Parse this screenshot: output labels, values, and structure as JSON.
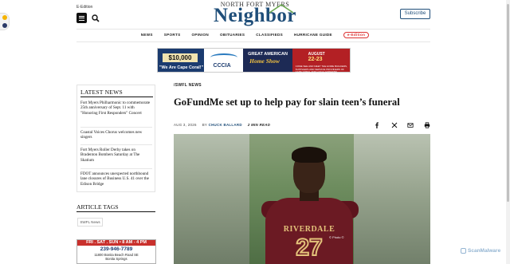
{
  "header": {
    "edition_label": "E-Edition",
    "logo_top": "NORTH FORT MYERS",
    "logo_main": "Neighbor",
    "subscribe_label": "Subscribe"
  },
  "nav": {
    "items": [
      "NEWS",
      "SPORTS",
      "OPINION",
      "OBITUARIES",
      "CLASSIFIEDS",
      "HURRICANE GUIDE"
    ],
    "eedition": "e-Edition"
  },
  "banner": {
    "amount": "$10,000",
    "cape_coral": "\"We Are Cape Coral!\"",
    "ccia": "CCCIA",
    "great_american": "GREAT AMERICAN",
    "home_show": "Home Show",
    "month": "AUGUST",
    "days": "22-23",
    "fine_print": "COME SEE AND MEET THE HOME BUILDERS, SUPPLIERS AND SERVICE PROVIDERS OF CAPE CORAL AND LOCAL EXPERTS!"
  },
  "sidebar": {
    "latest_title": "LATEST NEWS",
    "news": [
      "Fort Myers Philharmonic to commemorate 25th anniversary of Sept. 11 with \"Honoring First Responders\" Concert",
      "Coastal Voices Chorus welcomes new singers",
      "Fort Myers Roller Derby takes on Bradenton Bombers Saturday at The Skatium",
      "FDOT announces unexpected northbound lane closures of Business U.S. 41 over the Edison Bridge"
    ],
    "tags_title": "ARTICLE TAGS",
    "tag": "SWFL News",
    "ad": {
      "strip": "FRI . SAT . SUN  •  8 AM - 4 PM",
      "phone": "239-946-7789",
      "addr1": "11800 Bonita Beach Road SE",
      "addr2": "Bonita Springs"
    }
  },
  "article": {
    "category": "/SWFL NEWS",
    "headline": "GoFundMe set up to help pay for slain teen’s funeral",
    "date": "AUG 3, 2026",
    "by": "BY",
    "author": "CHUCK BALLARD",
    "read_time": "2 MIN READ",
    "photo_credit": "© Photo ©",
    "jersey_text": "RIVERDALE",
    "jersey_number": "27"
  },
  "watermark": "ScanMalware",
  "colors": {
    "brand_blue": "#1f4e79",
    "accent_red": "#d33333"
  }
}
